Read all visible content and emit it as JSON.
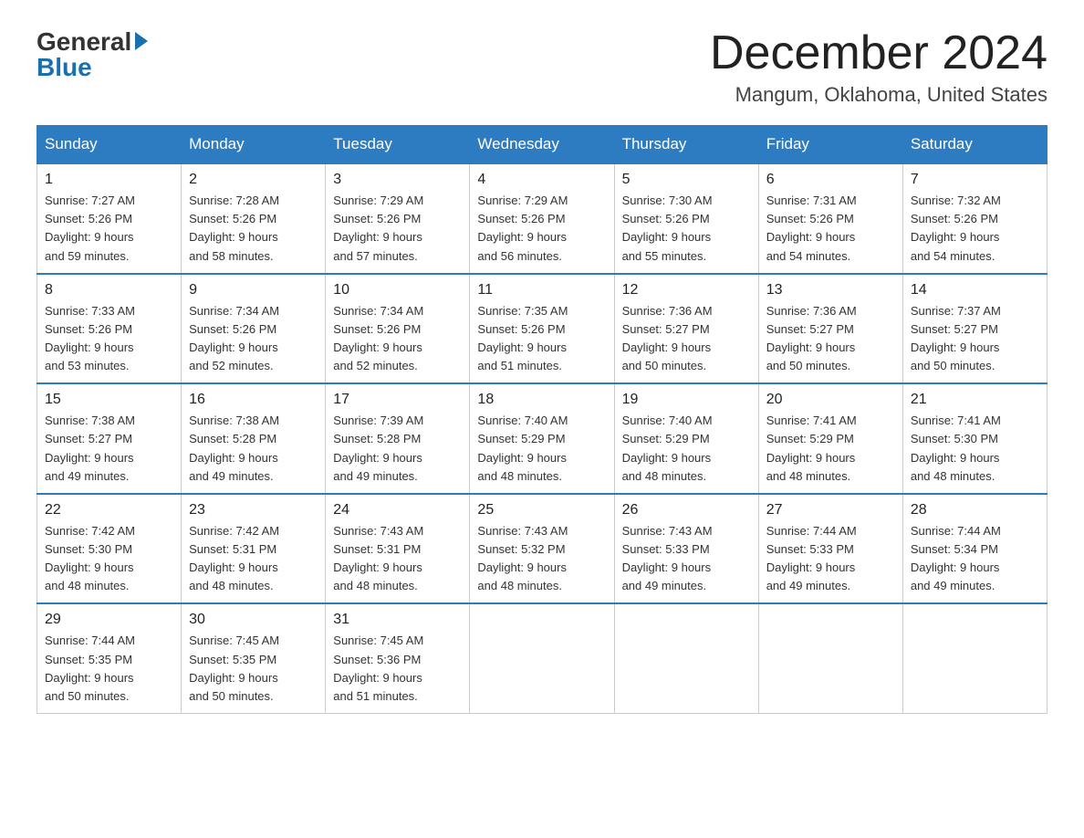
{
  "header": {
    "logo_general": "General",
    "logo_blue": "Blue",
    "month_title": "December 2024",
    "location": "Mangum, Oklahoma, United States"
  },
  "weekdays": [
    "Sunday",
    "Monday",
    "Tuesday",
    "Wednesday",
    "Thursday",
    "Friday",
    "Saturday"
  ],
  "weeks": [
    [
      {
        "day": "1",
        "sunrise": "7:27 AM",
        "sunset": "5:26 PM",
        "daylight": "9 hours and 59 minutes."
      },
      {
        "day": "2",
        "sunrise": "7:28 AM",
        "sunset": "5:26 PM",
        "daylight": "9 hours and 58 minutes."
      },
      {
        "day": "3",
        "sunrise": "7:29 AM",
        "sunset": "5:26 PM",
        "daylight": "9 hours and 57 minutes."
      },
      {
        "day": "4",
        "sunrise": "7:29 AM",
        "sunset": "5:26 PM",
        "daylight": "9 hours and 56 minutes."
      },
      {
        "day": "5",
        "sunrise": "7:30 AM",
        "sunset": "5:26 PM",
        "daylight": "9 hours and 55 minutes."
      },
      {
        "day": "6",
        "sunrise": "7:31 AM",
        "sunset": "5:26 PM",
        "daylight": "9 hours and 54 minutes."
      },
      {
        "day": "7",
        "sunrise": "7:32 AM",
        "sunset": "5:26 PM",
        "daylight": "9 hours and 54 minutes."
      }
    ],
    [
      {
        "day": "8",
        "sunrise": "7:33 AM",
        "sunset": "5:26 PM",
        "daylight": "9 hours and 53 minutes."
      },
      {
        "day": "9",
        "sunrise": "7:34 AM",
        "sunset": "5:26 PM",
        "daylight": "9 hours and 52 minutes."
      },
      {
        "day": "10",
        "sunrise": "7:34 AM",
        "sunset": "5:26 PM",
        "daylight": "9 hours and 52 minutes."
      },
      {
        "day": "11",
        "sunrise": "7:35 AM",
        "sunset": "5:26 PM",
        "daylight": "9 hours and 51 minutes."
      },
      {
        "day": "12",
        "sunrise": "7:36 AM",
        "sunset": "5:27 PM",
        "daylight": "9 hours and 50 minutes."
      },
      {
        "day": "13",
        "sunrise": "7:36 AM",
        "sunset": "5:27 PM",
        "daylight": "9 hours and 50 minutes."
      },
      {
        "day": "14",
        "sunrise": "7:37 AM",
        "sunset": "5:27 PM",
        "daylight": "9 hours and 50 minutes."
      }
    ],
    [
      {
        "day": "15",
        "sunrise": "7:38 AM",
        "sunset": "5:27 PM",
        "daylight": "9 hours and 49 minutes."
      },
      {
        "day": "16",
        "sunrise": "7:38 AM",
        "sunset": "5:28 PM",
        "daylight": "9 hours and 49 minutes."
      },
      {
        "day": "17",
        "sunrise": "7:39 AM",
        "sunset": "5:28 PM",
        "daylight": "9 hours and 49 minutes."
      },
      {
        "day": "18",
        "sunrise": "7:40 AM",
        "sunset": "5:29 PM",
        "daylight": "9 hours and 48 minutes."
      },
      {
        "day": "19",
        "sunrise": "7:40 AM",
        "sunset": "5:29 PM",
        "daylight": "9 hours and 48 minutes."
      },
      {
        "day": "20",
        "sunrise": "7:41 AM",
        "sunset": "5:29 PM",
        "daylight": "9 hours and 48 minutes."
      },
      {
        "day": "21",
        "sunrise": "7:41 AM",
        "sunset": "5:30 PM",
        "daylight": "9 hours and 48 minutes."
      }
    ],
    [
      {
        "day": "22",
        "sunrise": "7:42 AM",
        "sunset": "5:30 PM",
        "daylight": "9 hours and 48 minutes."
      },
      {
        "day": "23",
        "sunrise": "7:42 AM",
        "sunset": "5:31 PM",
        "daylight": "9 hours and 48 minutes."
      },
      {
        "day": "24",
        "sunrise": "7:43 AM",
        "sunset": "5:31 PM",
        "daylight": "9 hours and 48 minutes."
      },
      {
        "day": "25",
        "sunrise": "7:43 AM",
        "sunset": "5:32 PM",
        "daylight": "9 hours and 48 minutes."
      },
      {
        "day": "26",
        "sunrise": "7:43 AM",
        "sunset": "5:33 PM",
        "daylight": "9 hours and 49 minutes."
      },
      {
        "day": "27",
        "sunrise": "7:44 AM",
        "sunset": "5:33 PM",
        "daylight": "9 hours and 49 minutes."
      },
      {
        "day": "28",
        "sunrise": "7:44 AM",
        "sunset": "5:34 PM",
        "daylight": "9 hours and 49 minutes."
      }
    ],
    [
      {
        "day": "29",
        "sunrise": "7:44 AM",
        "sunset": "5:35 PM",
        "daylight": "9 hours and 50 minutes."
      },
      {
        "day": "30",
        "sunrise": "7:45 AM",
        "sunset": "5:35 PM",
        "daylight": "9 hours and 50 minutes."
      },
      {
        "day": "31",
        "sunrise": "7:45 AM",
        "sunset": "5:36 PM",
        "daylight": "9 hours and 51 minutes."
      },
      null,
      null,
      null,
      null
    ]
  ],
  "labels": {
    "sunrise_prefix": "Sunrise: ",
    "sunset_prefix": "Sunset: ",
    "daylight_prefix": "Daylight: "
  }
}
